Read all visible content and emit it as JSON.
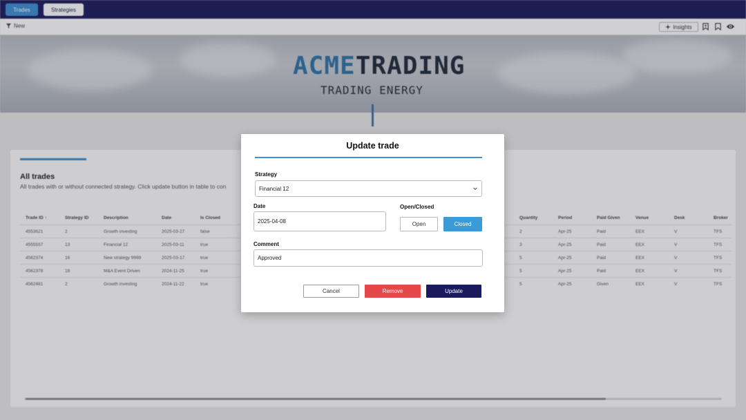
{
  "nav": {
    "trades_label": "Trades",
    "strategies_label": "Strategies"
  },
  "toolbar": {
    "filter_label": "New",
    "insights_label": "Insights"
  },
  "hero": {
    "brand_part1": "ACME",
    "brand_part2": "TRADING",
    "tagline": "TRADING ENERGY"
  },
  "card": {
    "title": "All trades",
    "subtitle": "All trades with or without connected strategy. Click update button in table to con"
  },
  "table": {
    "headers": [
      "Trade ID",
      "Strategy ID",
      "Description",
      "Date",
      "Is Closed",
      "Quantity",
      "Period",
      "Paid Given",
      "Venue",
      "Desk",
      "Broker"
    ],
    "sort_icon": "arrow-up-icon",
    "rows": [
      [
        "4553621",
        "2",
        "Growth investing",
        "2025-03-27",
        "false",
        "2",
        "Apr-25",
        "Paid",
        "EEX",
        "V",
        "TFS"
      ],
      [
        "4555557",
        "13",
        "Financial 12",
        "2025-03-11",
        "true",
        "3",
        "Apr-25",
        "Paid",
        "EEX",
        "V",
        "TFS"
      ],
      [
        "4562374",
        "16",
        "New strategy 9999",
        "2025-03-17",
        "true",
        "5",
        "Apr-25",
        "Paid",
        "EEX",
        "V",
        "TFS"
      ],
      [
        "4562378",
        "18",
        "M&A Event Driven",
        "2024-11-25",
        "true",
        "5",
        "Apr-25",
        "Paid",
        "EEX",
        "V",
        "TFS"
      ],
      [
        "4562481",
        "2",
        "Growth investing",
        "2024-11-22",
        "true",
        "5",
        "Apr-25",
        "Given",
        "EEX",
        "V",
        "TFS"
      ]
    ]
  },
  "modal": {
    "title": "Update trade",
    "strategy_label": "Strategy",
    "strategy_value": "Financial 12",
    "date_label": "Date",
    "date_value": "2025-04-08",
    "open_closed_label": "Open/Closed",
    "open_label": "Open",
    "closed_label": "Closed",
    "selected_state": "Closed",
    "comment_label": "Comment",
    "comment_value": "Approved",
    "cancel_label": "Cancel",
    "remove_label": "Remove",
    "update_label": "Update"
  },
  "colors": {
    "nav_bg": "#1c1c5e",
    "accent": "#3b8fd4",
    "remove": "#e8474a",
    "update": "#1a1a5e"
  }
}
